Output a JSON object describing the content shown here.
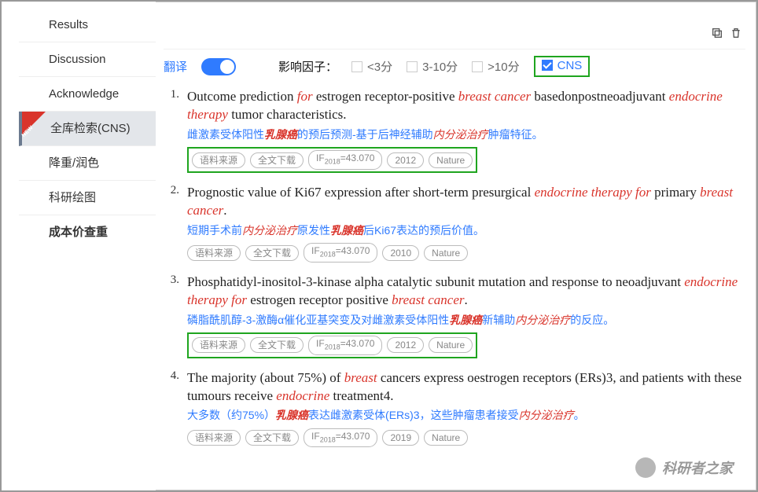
{
  "sidebar": {
    "items": [
      {
        "label": "Results"
      },
      {
        "label": "Discussion"
      },
      {
        "label": "Acknowledge"
      },
      {
        "label": "全库检索(CNS)",
        "active": true,
        "new": true
      },
      {
        "label": "降重/润色"
      },
      {
        "label": "科研绘图"
      },
      {
        "label": "成本价查重",
        "bold": true
      }
    ]
  },
  "filter": {
    "translate_label": "翻译",
    "impact_label": "影响因子：",
    "opts": [
      {
        "label": "<3分"
      },
      {
        "label": "3-10分"
      },
      {
        "label": ">10分"
      },
      {
        "label": "CNS",
        "checked": true,
        "highlight": true
      }
    ]
  },
  "tags_common": {
    "source": "语料来源",
    "download": "全文下载",
    "if_prefix": "IF",
    "if_year": "2018",
    "if_eq": "=",
    "journal": "Nature"
  },
  "results": [
    {
      "num": "1.",
      "en_parts": [
        "Outcome prediction ",
        {
          "hl": "for"
        },
        " estrogen receptor-positive ",
        {
          "hl": "breast cancer"
        },
        " basedonpostneoadjuvant ",
        {
          "hl": "endocrine therapy"
        },
        " tumor characteristics."
      ],
      "cn_parts": [
        "雌激素受体阳性",
        {
          "hlb": "乳腺癌"
        },
        "的预后预测-基于后神经辅助",
        {
          "hl": "内分泌治疗"
        },
        "肿瘤特征。"
      ],
      "if_value": "43.070",
      "year": "2012",
      "tags_highlight": true
    },
    {
      "num": "2.",
      "en_parts": [
        "Prognostic value of Ki67 expression after short-term presurgical ",
        {
          "hl": "endocrine therapy for"
        },
        " primary ",
        {
          "hl": "breast cancer"
        },
        "."
      ],
      "cn_parts": [
        "短期手术前",
        {
          "hl": "内分泌治疗"
        },
        "原发性",
        {
          "hlb": "乳腺癌"
        },
        "后Ki67表达的预后价值。"
      ],
      "if_value": "43.070",
      "year": "2010",
      "tags_highlight": false
    },
    {
      "num": "3.",
      "en_parts": [
        "Phosphatidyl-inositol-3-kinase alpha catalytic subunit mutation and response to neoadjuvant ",
        {
          "hl": "endocrine therapy for"
        },
        " estrogen receptor positive ",
        {
          "hl": "breast cancer"
        },
        "."
      ],
      "cn_parts": [
        "磷脂酰肌醇-3-激酶α催化亚基突变及对雌激素受体阳性",
        {
          "hlb": "乳腺癌"
        },
        "新辅助",
        {
          "hl": "内分泌治疗"
        },
        "的反应。"
      ],
      "if_value": "43.070",
      "year": "2012",
      "tags_highlight": true
    },
    {
      "num": "4.",
      "en_parts": [
        "The majority (about 75%) of ",
        {
          "hl": "breast"
        },
        " cancers express oestrogen receptors (ERs)3, and patients with these tumours receive ",
        {
          "hl": "endocrine"
        },
        " treatment4."
      ],
      "cn_parts": [
        "大多数（约75%）",
        {
          "hlb": "乳腺癌"
        },
        "表达雌激素受体(ERs)3，这些肿瘤患者接受",
        {
          "hl": "内分泌治疗"
        },
        "。"
      ],
      "if_value": "43.070",
      "year": "2019",
      "tags_highlight": false
    }
  ],
  "watermark": "科研者之家"
}
